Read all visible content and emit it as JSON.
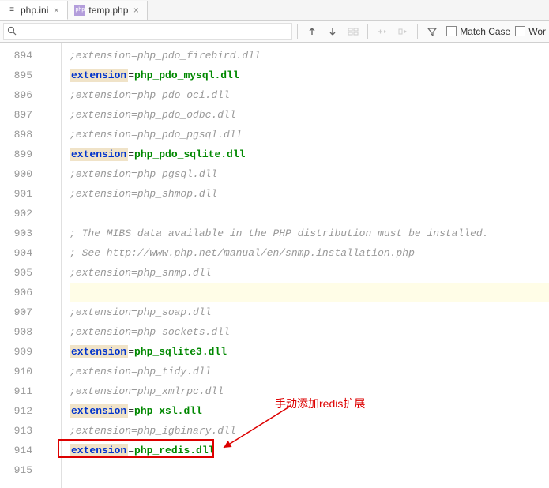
{
  "tabs": [
    {
      "name": "php.ini",
      "icon": "≡",
      "active": true
    },
    {
      "name": "temp.php",
      "icon": "php",
      "active": false
    }
  ],
  "toolbar": {
    "search_placeholder": "",
    "match_case": "Match Case",
    "words": "Wor"
  },
  "gutter_start": 894,
  "lines": [
    {
      "n": 894,
      "type": "comment",
      "text": ";extension=php_pdo_firebird.dll"
    },
    {
      "n": 895,
      "type": "kv",
      "key": "extension",
      "value": "php_pdo_mysql.dll"
    },
    {
      "n": 896,
      "type": "comment",
      "text": ";extension=php_pdo_oci.dll"
    },
    {
      "n": 897,
      "type": "comment",
      "text": ";extension=php_pdo_odbc.dll"
    },
    {
      "n": 898,
      "type": "comment",
      "text": ";extension=php_pdo_pgsql.dll"
    },
    {
      "n": 899,
      "type": "kv",
      "key": "extension",
      "value": "php_pdo_sqlite.dll"
    },
    {
      "n": 900,
      "type": "comment",
      "text": ";extension=php_pgsql.dll"
    },
    {
      "n": 901,
      "type": "comment",
      "text": ";extension=php_shmop.dll"
    },
    {
      "n": 902,
      "type": "blank",
      "text": ""
    },
    {
      "n": 903,
      "type": "comment",
      "text": "; The MIBS data available in the PHP distribution must be installed."
    },
    {
      "n": 904,
      "type": "comment",
      "text": "; See http://www.php.net/manual/en/snmp.installation.php"
    },
    {
      "n": 905,
      "type": "comment",
      "text": ";extension=php_snmp.dll"
    },
    {
      "n": 906,
      "type": "blank-hl",
      "text": ""
    },
    {
      "n": 907,
      "type": "comment",
      "text": ";extension=php_soap.dll"
    },
    {
      "n": 908,
      "type": "comment",
      "text": ";extension=php_sockets.dll"
    },
    {
      "n": 909,
      "type": "kv",
      "key": "extension",
      "value": "php_sqlite3.dll"
    },
    {
      "n": 910,
      "type": "comment",
      "text": ";extension=php_tidy.dll"
    },
    {
      "n": 911,
      "type": "comment",
      "text": ";extension=php_xmlrpc.dll"
    },
    {
      "n": 912,
      "type": "kv",
      "key": "extension",
      "value": "php_xsl.dll"
    },
    {
      "n": 913,
      "type": "comment",
      "text": ";extension=php_igbinary.dll"
    },
    {
      "n": 914,
      "type": "kv",
      "key": "extension",
      "value": "php_redis.dll"
    },
    {
      "n": 915,
      "type": "blank",
      "text": ""
    }
  ],
  "annotation": {
    "text": "手动添加redis扩展"
  }
}
